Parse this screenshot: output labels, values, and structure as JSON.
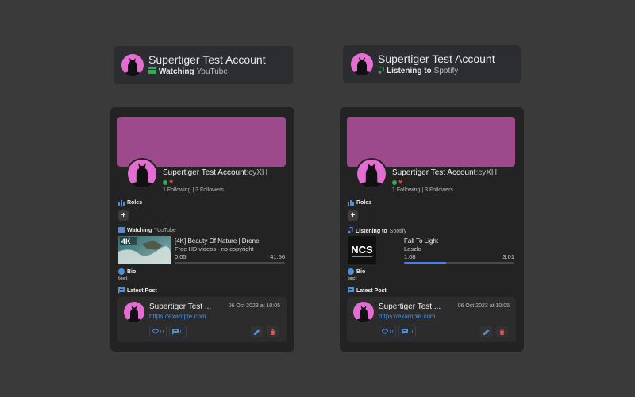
{
  "colors": {
    "accent": "#4c8fdc",
    "avatar": "#e36ed1",
    "banner": "#9c4a8c",
    "progress": "#3b82f6",
    "online": "#3ba55c",
    "heart": "#e03c3c",
    "delete": "#e05555"
  },
  "pills": [
    {
      "name": "Supertiger Test Account",
      "activity_verb": "Watching",
      "activity_target": "YouTube",
      "activity_icon": "youtube-icon"
    },
    {
      "name": "Supertiger Test Account",
      "activity_verb": "Listening to",
      "activity_target": "Spotify",
      "activity_icon": "music-note-icon"
    }
  ],
  "cards": [
    {
      "username": "Supertiger Test Account",
      "tag": ":cyXH",
      "heart": "♥",
      "follow_text": "1 Following | 3 Followers",
      "roles_label": "Roles",
      "add_role_label": "+",
      "activity_verb": "Watching",
      "activity_target": "YouTube",
      "activity_title": "[4K] Beauty Of Nature | Drone",
      "activity_subtitle": "Free HD videos - no copyright",
      "time_elapsed": "0:05",
      "time_total": "41:56",
      "progress": 0.002,
      "thumbnail_badge": "4K",
      "bio_label": "Bio",
      "bio_text": "test",
      "latest_post_label": "Latest Post",
      "post": {
        "author": "Supertiger Test ...",
        "date": "06 Oct 2023 at 10:05",
        "link": "https://example.com",
        "likes": "0",
        "comments": "0"
      }
    },
    {
      "username": "Supertiger Test Account",
      "tag": ":cyXH",
      "heart": "♥",
      "follow_text": "1 Following | 3 Followers",
      "roles_label": "Roles",
      "add_role_label": "+",
      "activity_verb": "Listening to",
      "activity_target": "Spotify",
      "activity_title": "Fall To Light",
      "activity_subtitle": "Laszlo",
      "time_elapsed": "1:08",
      "time_total": "3:01",
      "progress": 0.38,
      "thumbnail_badge": "NCS",
      "bio_label": "Bio",
      "bio_text": "test",
      "latest_post_label": "Latest Post",
      "post": {
        "author": "Supertiger Test ...",
        "date": "06 Oct 2023 at 10:05",
        "link": "https://example.com",
        "likes": "0",
        "comments": "0"
      }
    }
  ]
}
